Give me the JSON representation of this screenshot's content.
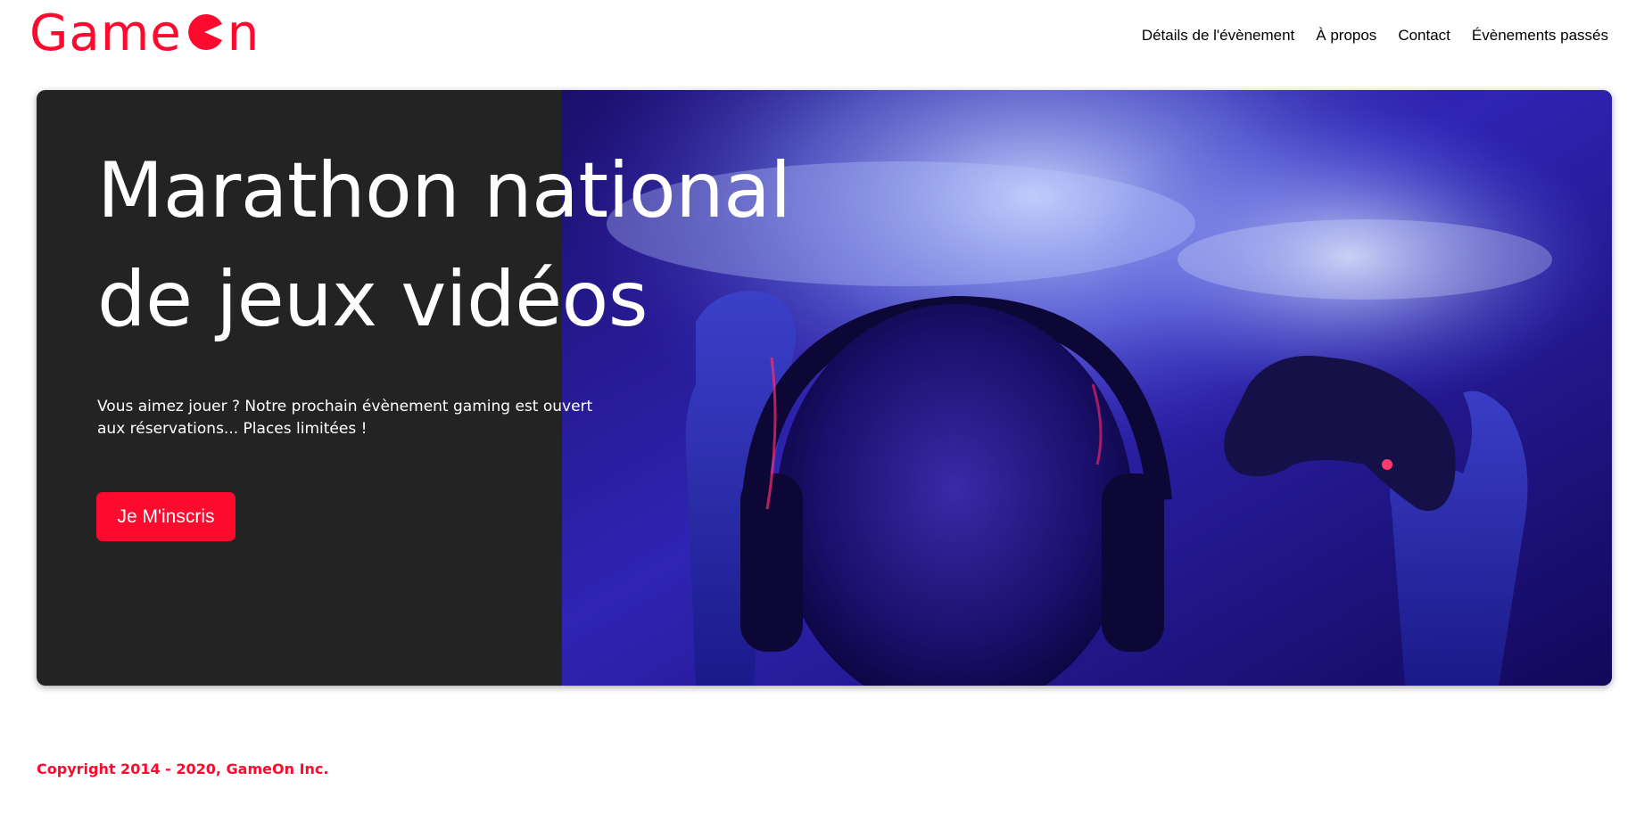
{
  "colors": {
    "brand": "#ff0a2f",
    "hero_background": "#232323",
    "text_light": "#ffffff",
    "nav_text": "#000000"
  },
  "header": {
    "logo": {
      "text_start": "Game",
      "text_end": "n"
    },
    "nav": [
      {
        "label": "Détails de l'évènement"
      },
      {
        "label": "À propos"
      },
      {
        "label": "Contact"
      },
      {
        "label": "Évènements passés"
      }
    ]
  },
  "hero": {
    "title_line1": "Marathon national",
    "title_line2": "de jeux vidéos",
    "text_line1": "Vous aimez jouer ? Notre prochain évènement gaming est ouvert",
    "text_line2": "aux réservations... Places limitées !",
    "cta_label": "Je M'inscris",
    "image_icon": "gamer-with-headphones-and-controller-photo"
  },
  "footer": {
    "copyright": "Copyright 2014 - 2020, GameOn Inc."
  }
}
